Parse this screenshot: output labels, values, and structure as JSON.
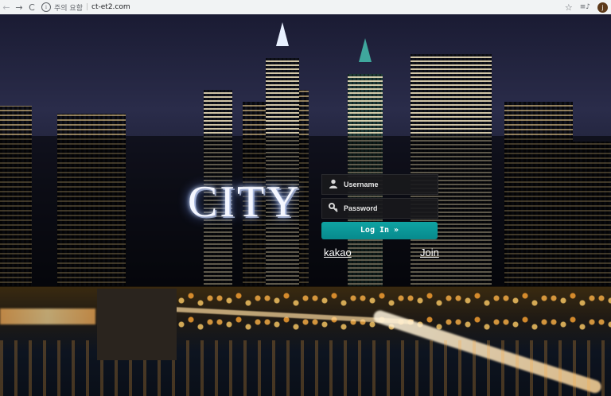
{
  "browser": {
    "back_icon": "←",
    "forward_icon": "→",
    "reload_icon": "C",
    "info_icon": "i",
    "security_label": "주의 요함",
    "url": "ct-et2.com",
    "star_icon": "☆",
    "playlist_icon": "≡♪",
    "avatar_initial": "j"
  },
  "login": {
    "logo_text": "CITY",
    "username_placeholder": "Username",
    "password_placeholder": "Password",
    "login_button": "Log In »",
    "kakao_link": "kakao",
    "join_link": "Join"
  }
}
